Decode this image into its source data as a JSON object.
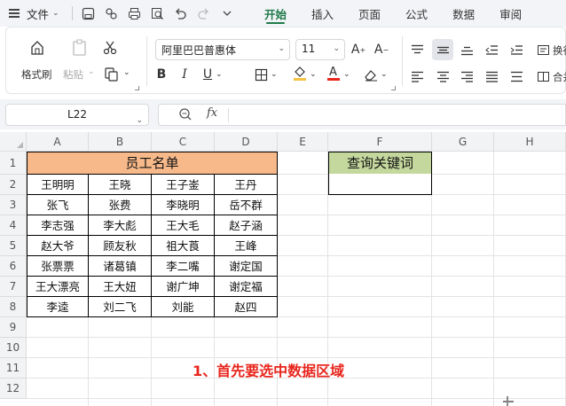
{
  "menu": {
    "file_label": "文件",
    "tabs": [
      {
        "label": "开始",
        "active": true
      },
      {
        "label": "插入",
        "active": false
      },
      {
        "label": "页面",
        "active": false
      },
      {
        "label": "公式",
        "active": false
      },
      {
        "label": "数据",
        "active": false
      },
      {
        "label": "审阅",
        "active": false
      }
    ],
    "accent_color": "#1f7a4a"
  },
  "ribbon": {
    "format_painter": "格式刷",
    "paste": "粘贴",
    "font_name": "阿里巴巴普惠体",
    "font_size": "11",
    "wrap_label": "换行",
    "merge_label": "合并"
  },
  "formula_bar": {
    "name_box": "L22",
    "fx_label": "fx",
    "formula": ""
  },
  "sheet": {
    "columns": [
      "A",
      "B",
      "C",
      "D",
      "E",
      "F",
      "G",
      "H"
    ],
    "rows": [
      "1",
      "2",
      "3",
      "4",
      "5",
      "6",
      "7",
      "8",
      "9",
      "10",
      "11",
      "12"
    ],
    "title": "员工名单",
    "names": [
      [
        "王明明",
        "王晓",
        "王子崟",
        "王丹"
      ],
      [
        "张飞",
        "张费",
        "李晓明",
        "岳不群"
      ],
      [
        "李志强",
        "李大彪",
        "王大毛",
        "赵子涵"
      ],
      [
        "赵大爷",
        "顾友秋",
        "祖大莨",
        "王峰"
      ],
      [
        "张票票",
        "诸葛镇",
        "李二嘴",
        "谢定国"
      ],
      [
        "王大漂亮",
        "王大妞",
        "谢广坤",
        "谢定福"
      ],
      [
        "李逵",
        "刘二飞",
        "刘能",
        "赵四"
      ]
    ],
    "keyword_title": "查询关键词",
    "keyword_value": "",
    "header_fill": "#f7b98a",
    "keyword_fill": "#c4d89e"
  },
  "annotation": {
    "text": "1、首先要选中数据区域",
    "color": "#e8261c"
  }
}
